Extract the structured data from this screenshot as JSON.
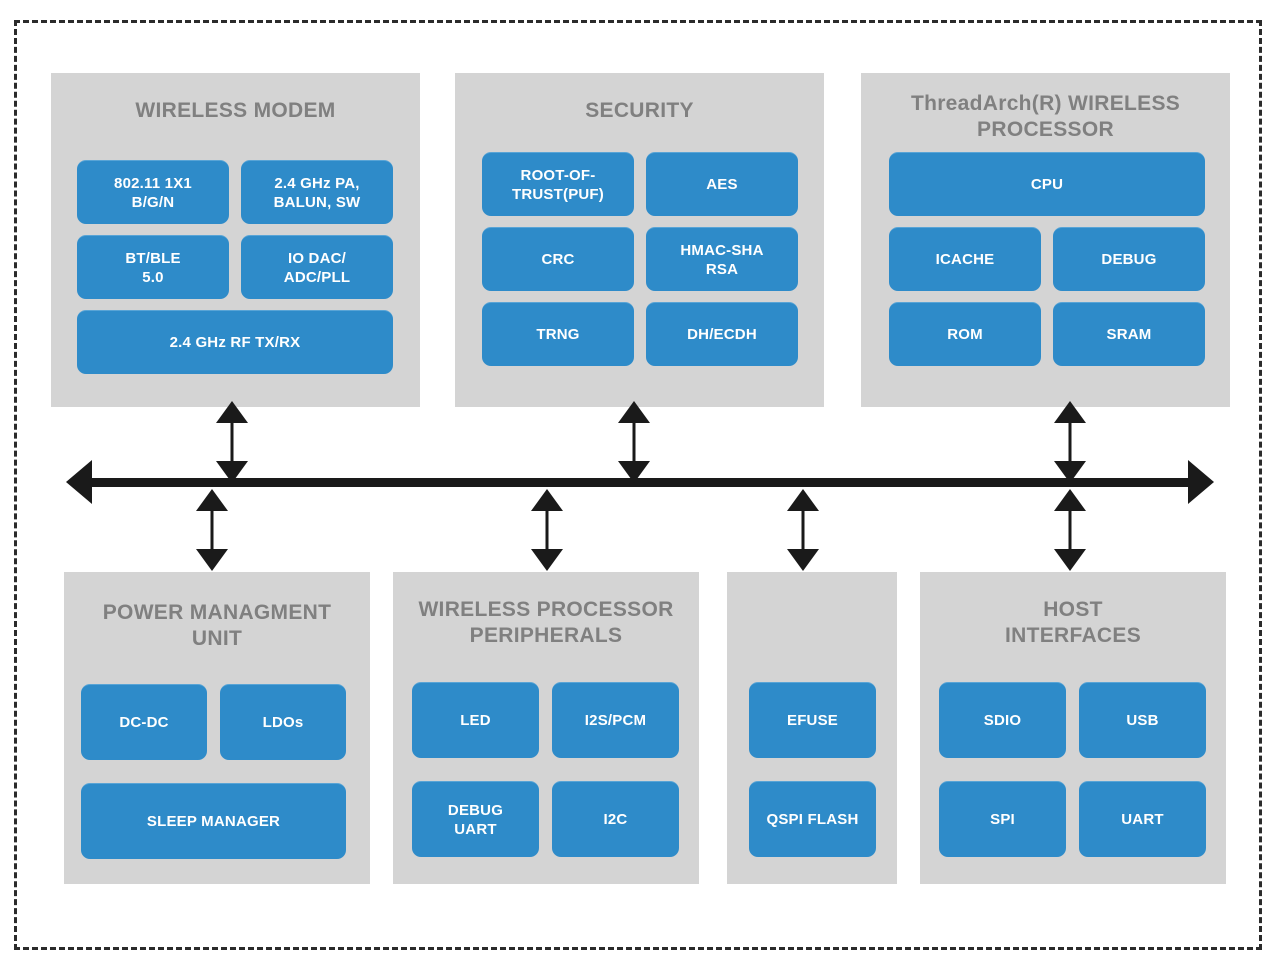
{
  "diagram": {
    "title_present": false,
    "colors": {
      "block_blue": "#2e8bc9",
      "panel_gray": "#d4d4d4",
      "title_gray": "#808080",
      "line_black": "#1a1a1a",
      "block_text": "#ffffff",
      "background": "#ffffff"
    },
    "boundary": {
      "style": "dashed",
      "name": "chip-boundary"
    }
  },
  "panels": [
    {
      "id": "wireless-modem",
      "title": "WIRELESS MODEM",
      "blocks": [
        {
          "id": "wifi-80211",
          "label": "802.11 1X1\nB/G/N"
        },
        {
          "id": "pa-balun-sw",
          "label": "2.4 GHz PA,\nBALUN, SW"
        },
        {
          "id": "bt-ble",
          "label": "BT/BLE\n5.0"
        },
        {
          "id": "io-dac-adc-pll",
          "label": "IO DAC/\nADC/PLL"
        },
        {
          "id": "rf-tx-rx",
          "label": "2.4 GHz RF TX/RX"
        }
      ]
    },
    {
      "id": "security",
      "title": "SECURITY",
      "blocks": [
        {
          "id": "root-of-trust",
          "label": "ROOT-OF-\nTRUST(PUF)"
        },
        {
          "id": "aes",
          "label": "AES"
        },
        {
          "id": "crc",
          "label": "CRC"
        },
        {
          "id": "hmac-sha-rsa",
          "label": "HMAC-SHA\nRSA"
        },
        {
          "id": "trng",
          "label": "TRNG"
        },
        {
          "id": "dh-ecdh",
          "label": "DH/ECDH"
        }
      ]
    },
    {
      "id": "threadarch-wireless-processor",
      "title": "ThreadArch(R) WIRELESS\nPROCESSOR",
      "blocks": [
        {
          "id": "cpu",
          "label": "CPU"
        },
        {
          "id": "icache",
          "label": "ICACHE"
        },
        {
          "id": "debug",
          "label": "DEBUG"
        },
        {
          "id": "rom",
          "label": "ROM"
        },
        {
          "id": "sram",
          "label": "SRAM"
        }
      ]
    },
    {
      "id": "power-management-unit",
      "title": "POWER MANAGMENT\nUNIT",
      "blocks": [
        {
          "id": "dc-dc",
          "label": "DC-DC"
        },
        {
          "id": "ldos",
          "label": "LDOs"
        },
        {
          "id": "sleep-manager",
          "label": "SLEEP MANAGER"
        }
      ]
    },
    {
      "id": "wireless-processor-peripherals",
      "title": "WIRELESS PROCESSOR\nPERIPHERALS",
      "blocks": [
        {
          "id": "led",
          "label": "LED"
        },
        {
          "id": "i2s-pcm",
          "label": "I2S/PCM"
        },
        {
          "id": "debug-uart",
          "label": "DEBUG\nUART"
        },
        {
          "id": "i2c",
          "label": "I2C"
        }
      ]
    },
    {
      "id": "memory-group",
      "title": "",
      "blocks": [
        {
          "id": "efuse",
          "label": "EFUSE"
        },
        {
          "id": "qspi-flash",
          "label": "QSPI FLASH"
        }
      ]
    },
    {
      "id": "host-interfaces",
      "title": "HOST\nINTERFACES",
      "blocks": [
        {
          "id": "sdio",
          "label": "SDIO"
        },
        {
          "id": "usb",
          "label": "USB"
        },
        {
          "id": "spi",
          "label": "SPI"
        },
        {
          "id": "uart",
          "label": "UART"
        }
      ]
    }
  ],
  "bus": {
    "name": "system-bus",
    "orientation": "horizontal",
    "left_arrow": true,
    "right_arrow": true,
    "connections": [
      {
        "id": "bus-to-wireless-modem",
        "side": "top",
        "target": "wireless-modem"
      },
      {
        "id": "bus-to-security",
        "side": "top",
        "target": "security"
      },
      {
        "id": "bus-to-threadarch",
        "side": "top",
        "target": "threadarch-wireless-processor"
      },
      {
        "id": "bus-to-pmu",
        "side": "bottom",
        "target": "power-management-unit"
      },
      {
        "id": "bus-to-peripherals",
        "side": "bottom",
        "target": "wireless-processor-peripherals"
      },
      {
        "id": "bus-to-memory",
        "side": "bottom",
        "target": "memory-group"
      },
      {
        "id": "bus-to-host-interfaces",
        "side": "bottom",
        "target": "host-interfaces"
      }
    ]
  }
}
